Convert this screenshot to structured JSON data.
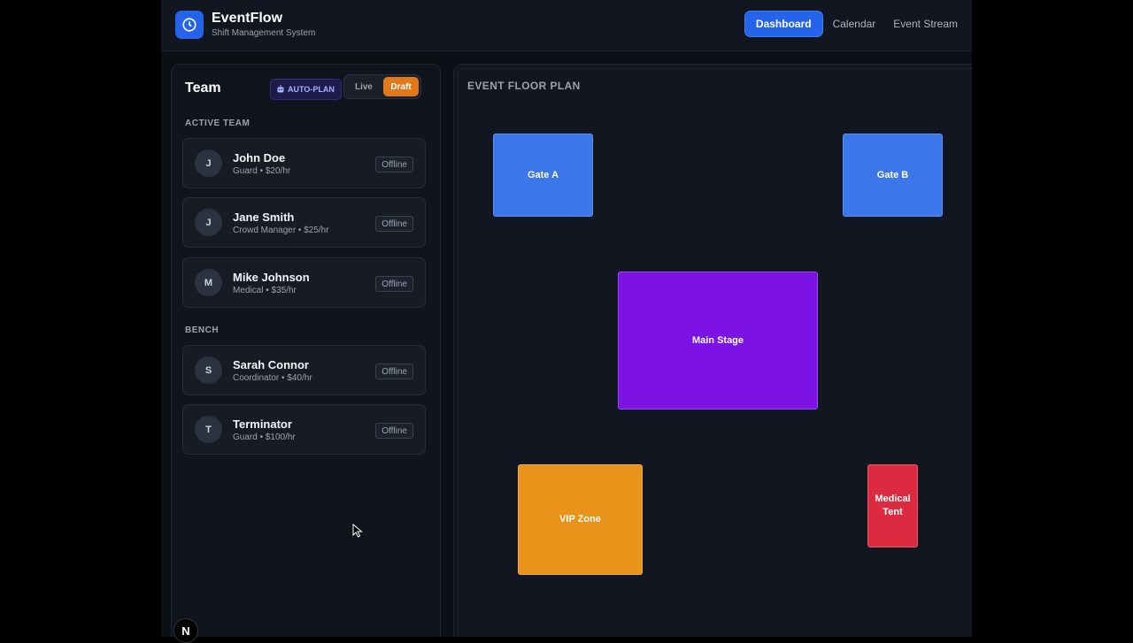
{
  "header": {
    "app_title": "EventFlow",
    "app_subtitle": "Shift Management System",
    "logo_icon": "clock-icon",
    "nav": [
      {
        "label": "Dashboard",
        "active": true
      },
      {
        "label": "Calendar",
        "active": false
      },
      {
        "label": "Event Stream",
        "active": false
      }
    ]
  },
  "team": {
    "title": "Team",
    "autoplan_label": "AUTO-PLAN",
    "autoplan_icon": "robot-icon",
    "mode_live": "Live",
    "mode_draft": "Draft",
    "active_label": "ACTIVE TEAM",
    "active": [
      {
        "initial": "J",
        "name": "John Doe",
        "meta": "Guard • $20/hr",
        "status": "Offline"
      },
      {
        "initial": "J",
        "name": "Jane Smith",
        "meta": "Crowd Manager • $25/hr",
        "status": "Offline"
      },
      {
        "initial": "M",
        "name": "Mike Johnson",
        "meta": "Medical • $35/hr",
        "status": "Offline"
      }
    ],
    "bench_label": "BENCH",
    "bench": [
      {
        "initial": "S",
        "name": "Sarah Connor",
        "meta": "Coordinator • $40/hr",
        "status": "Offline"
      },
      {
        "initial": "T",
        "name": "Terminator",
        "meta": "Guard • $100/hr",
        "status": "Offline"
      }
    ]
  },
  "floor": {
    "title": "EVENT FLOOR PLAN",
    "zones": [
      {
        "label": "Gate A",
        "color": "#3b76ea"
      },
      {
        "label": "Gate B",
        "color": "#3b76ea"
      },
      {
        "label": "Main Stage",
        "color": "#7c12e4"
      },
      {
        "label": "VIP Zone",
        "color": "#e89319"
      },
      {
        "label": "Medical Tent",
        "color": "#dc2a41"
      }
    ]
  },
  "dev_badge": "N"
}
